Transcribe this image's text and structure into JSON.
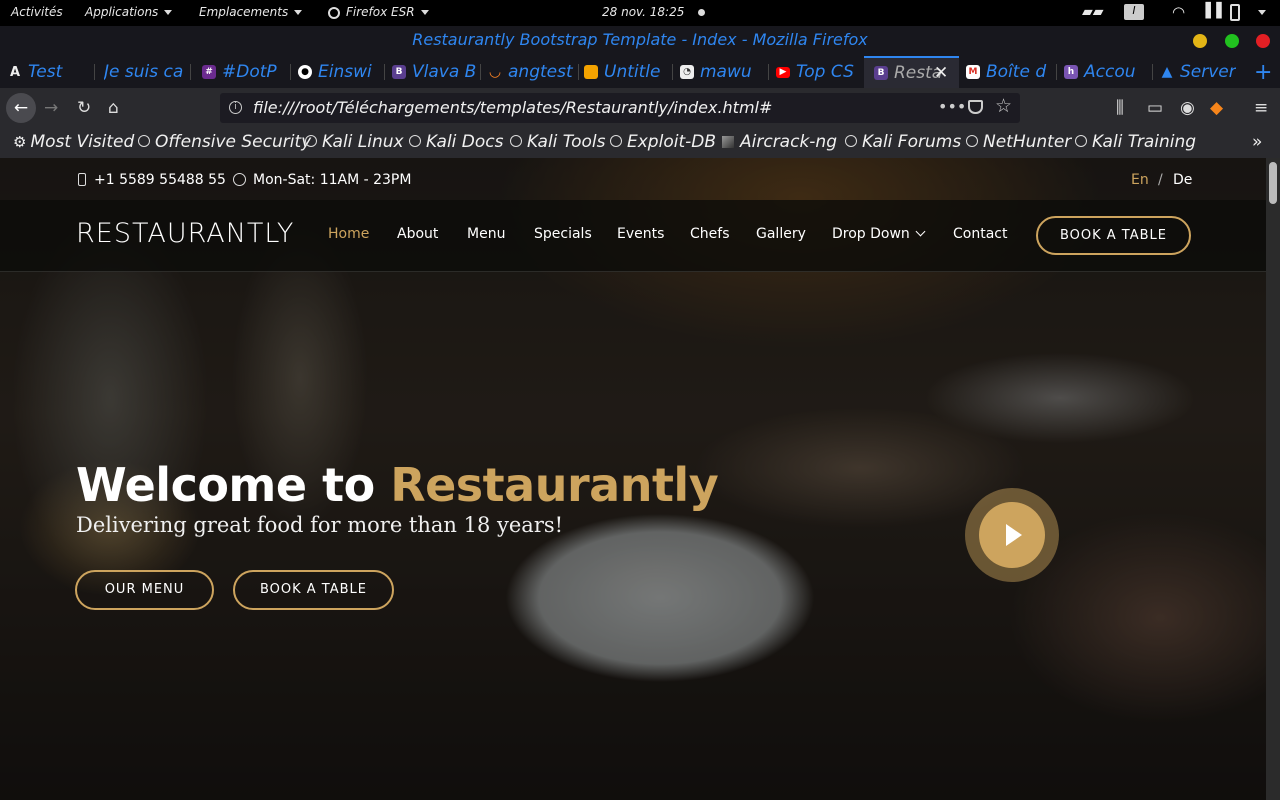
{
  "gnome_bar": {
    "activities": "Activités",
    "applications": "Applications",
    "places": "Emplacements",
    "app_name": "Firefox ESR",
    "datetime": "28 nov.  18:25"
  },
  "window": {
    "title": "Restaurantly Bootstrap Template - Index - Mozilla Firefox"
  },
  "tabs": [
    {
      "label": "Test",
      "icon": "a-icon"
    },
    {
      "label": "Je suis ca",
      "icon": "none"
    },
    {
      "label": "#DotP",
      "icon": "slack-icon"
    },
    {
      "label": "Einswi",
      "icon": "github-icon"
    },
    {
      "label": "Vlava B",
      "icon": "bootstrap-icon"
    },
    {
      "label": "angtest",
      "icon": "stackoverflow-icon"
    },
    {
      "label": "Untitle",
      "icon": "notebook-icon"
    },
    {
      "label": "mawu",
      "icon": "app-icon"
    },
    {
      "label": "Top CS",
      "icon": "youtube-icon"
    },
    {
      "label": "Resta",
      "icon": "bootstrap-icon",
      "active": true
    },
    {
      "label": "Boîte d",
      "icon": "gmail-icon"
    },
    {
      "label": "Accou",
      "icon": "heroku-icon"
    },
    {
      "label": "Server",
      "icon": "warning-icon"
    }
  ],
  "navbar": {
    "url": "file:///root/Téléchargements/templates/Restaurantly/index.html#"
  },
  "bookmarks": [
    "Most Visited",
    "Offensive Security",
    "Kali Linux",
    "Kali Docs",
    "Kali Tools",
    "Exploit-DB",
    "Aircrack-ng",
    "Kali Forums",
    "NetHunter",
    "Kali Training"
  ],
  "page": {
    "phone": "+1 5589 55488 55",
    "hours": "Mon-Sat: 11AM - 23PM",
    "lang_en": "En",
    "lang_sep": "/",
    "lang_de": "De",
    "logo": "RESTAURANTLY",
    "menu": [
      "Home",
      "About",
      "Menu",
      "Specials",
      "Events",
      "Chefs",
      "Gallery",
      "Drop Down",
      "Contact"
    ],
    "book_table": "BOOK A TABLE",
    "hero_title_1": "Welcome to ",
    "hero_title_2": "Restaurantly",
    "hero_subtitle": "Delivering great food for more than 18 years!",
    "btn_menu": "OUR MENU",
    "btn_book": "BOOK A TABLE",
    "accent_color": "#cda45e"
  }
}
